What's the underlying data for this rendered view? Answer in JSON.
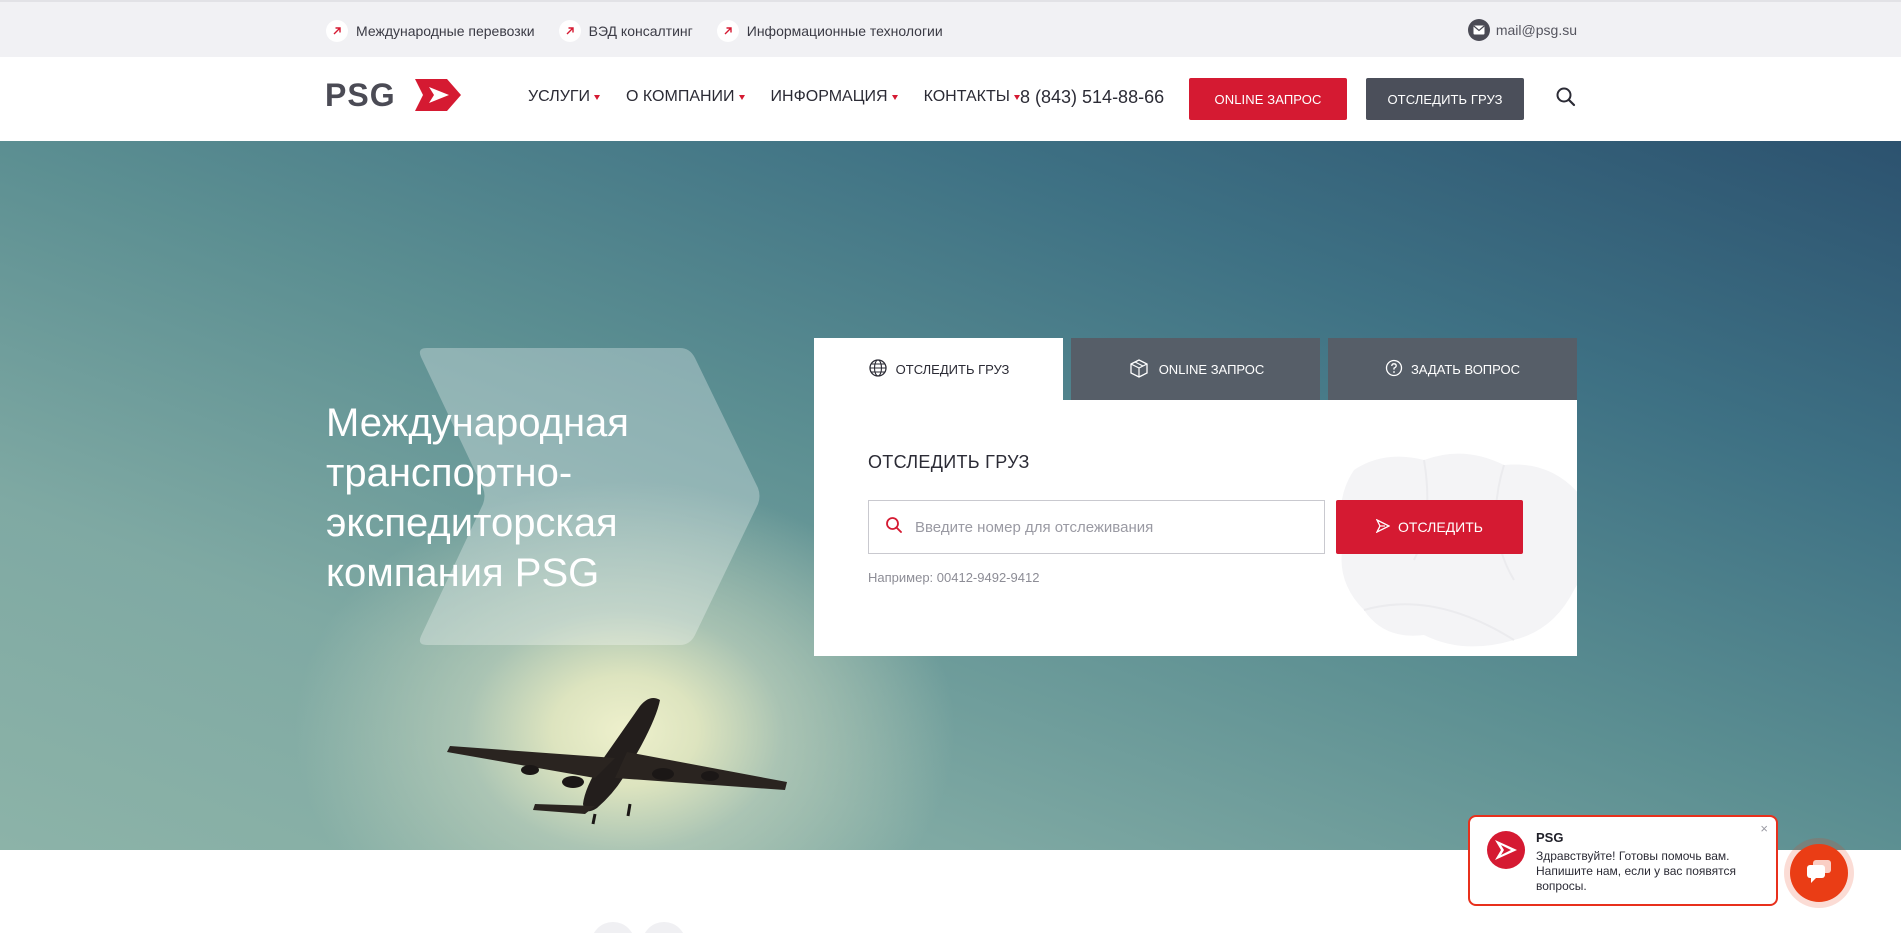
{
  "topbar": {
    "links": [
      {
        "label": "Международные перевозки"
      },
      {
        "label": "ВЭД консалтинг"
      },
      {
        "label": "Информационные технологии"
      }
    ],
    "email": "mail@psg.su"
  },
  "header": {
    "logo_text": "PSG",
    "nav": [
      {
        "label": "УСЛУГИ"
      },
      {
        "label": "О КОМПАНИИ"
      },
      {
        "label": "ИНФОРМАЦИЯ"
      },
      {
        "label": "КОНТАКТЫ"
      }
    ],
    "phone": "8 (843) 514-88-66",
    "online_request_label": "ONLINE ЗАПРОС",
    "track_cargo_label": "ОТСЛЕДИТЬ ГРУЗ"
  },
  "hero": {
    "title": "Международная транспортно-экспедиторская компания PSG"
  },
  "tracking": {
    "tabs": [
      {
        "label": "ОТСЛЕДИТЬ ГРУЗ",
        "icon": "globe-icon",
        "active": true
      },
      {
        "label": "ONLINE ЗАПРОС",
        "icon": "parcel-icon",
        "active": false
      },
      {
        "label": "ЗАДАТЬ ВОПРОС",
        "icon": "question-icon",
        "active": false
      }
    ],
    "title": "ОТСЛЕДИТЬ ГРУЗ",
    "input_value": "",
    "input_placeholder": "Введите номер для отслеживания",
    "button_label": "ОТСЛЕДИТЬ",
    "example": "Например: 00412-9492-9412"
  },
  "chat": {
    "name": "PSG",
    "message": "Здравствуйте! Готовы помочь вам. Напишите нам, если у вас появятся вопросы.",
    "close": "×"
  },
  "colors": {
    "accent": "#d51a32",
    "dark_button": "#4b4f5a",
    "tab_inactive": "#565e68",
    "chat_accent": "#ea3d15"
  }
}
